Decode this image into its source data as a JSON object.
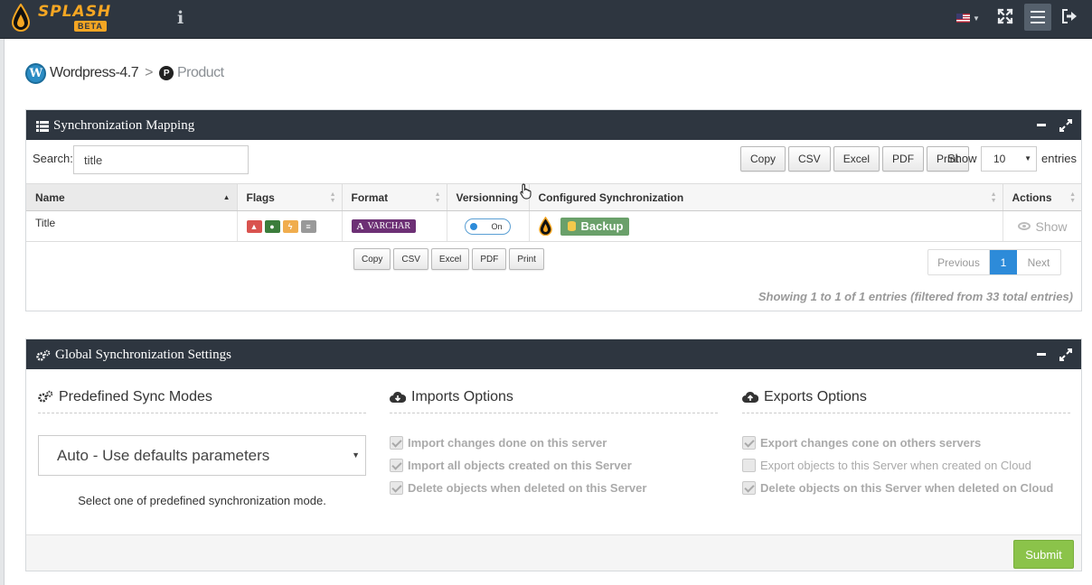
{
  "topbar": {
    "logo_text": "SPLASH",
    "logo_badge": "BETA",
    "info_glyph": "i",
    "icons": [
      "info-icon",
      "us-flag-icon",
      "expand-icon",
      "menu-icon",
      "logout-icon"
    ]
  },
  "breadcrumb": {
    "parent": "Wordpress-4.7",
    "separator": ">",
    "current": "Product",
    "wp_glyph": "W",
    "p_glyph": "P"
  },
  "sync_panel": {
    "title": "Synchronization Mapping",
    "search_label": "Search:",
    "search_value": "title",
    "buttons": [
      "Copy",
      "CSV",
      "Excel",
      "PDF",
      "Print"
    ],
    "show_label": "Show",
    "entries_value": "10",
    "entries_label": "entries",
    "columns": [
      "Name",
      "Flags",
      "Format",
      "Versionning",
      "Configured Synchronization",
      "Actions"
    ],
    "rows": [
      {
        "name": "Title",
        "format_glyph": "A",
        "format": "VARCHAR",
        "toggle": "On",
        "sync": "Backup",
        "action": "Show"
      }
    ],
    "pagination": {
      "prev": "Previous",
      "page": "1",
      "next": "Next"
    },
    "info": "Showing 1 to 1 of 1 entries (filtered from 33 total entries)"
  },
  "global_panel": {
    "title": "Global Synchronization Settings",
    "predefined": {
      "title": "Predefined Sync Modes",
      "selected": "Auto - Use defaults parameters",
      "help": "Select one of predefined synchronization mode."
    },
    "imports": {
      "title": "Imports Options",
      "options": [
        {
          "label": "Import changes done on this server",
          "checked": true
        },
        {
          "label": "Import all objects created on this Server",
          "checked": true
        },
        {
          "label": "Delete objects when deleted on this Server",
          "checked": true
        }
      ]
    },
    "exports": {
      "title": "Exports Options",
      "options": [
        {
          "label": "Export changes cone on others servers",
          "checked": true
        },
        {
          "label": "Export objects to this Server when created on Cloud",
          "checked": false
        },
        {
          "label": "Delete objects on this Server when deleted on Cloud",
          "checked": true
        }
      ]
    },
    "submit": "Submit"
  },
  "colors": {
    "topbar": "#2e3640",
    "accent_orange": "#f5a623",
    "primary_blue": "#2d8bd9",
    "success_green": "#8bc34a",
    "backup_green": "#6aa06a",
    "format_purple": "#6d3075"
  }
}
